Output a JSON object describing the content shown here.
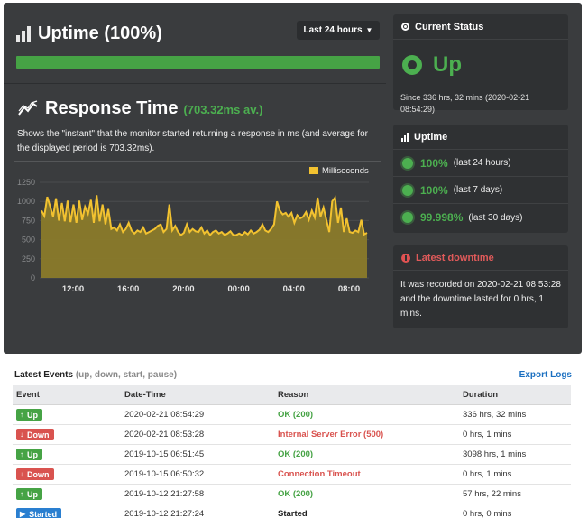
{
  "uptime_header": {
    "title": "Uptime (100%)",
    "range_label": "Last 24 hours",
    "uptime_fraction": 1.0
  },
  "response": {
    "title": "Response Time",
    "average": "(703.32ms av.)",
    "description": "Shows the \"instant\" that the monitor started returning a response in ms (and average for the displayed period is 703.32ms)."
  },
  "chart_data": {
    "type": "area",
    "legend": "Milliseconds",
    "ylim": [
      0,
      1250
    ],
    "yticks": [
      "1250",
      "1000",
      "750",
      "500",
      "250",
      "0"
    ],
    "xticks": [
      "12:00",
      "16:00",
      "20:00",
      "00:00",
      "04:00",
      "08:00"
    ],
    "color": "#f2c230",
    "values": [
      880,
      810,
      1060,
      930,
      800,
      1040,
      750,
      980,
      740,
      1010,
      730,
      960,
      720,
      1010,
      760,
      930,
      840,
      1020,
      720,
      1080,
      740,
      960,
      700,
      900,
      640,
      660,
      620,
      700,
      600,
      640,
      720,
      620,
      580,
      620,
      600,
      660,
      580,
      600,
      620,
      640,
      680,
      700,
      600,
      640,
      960,
      620,
      680,
      600,
      560,
      590,
      700,
      600,
      640,
      610,
      600,
      660,
      580,
      620,
      560,
      600,
      620,
      580,
      600,
      560,
      580,
      610,
      560,
      560,
      580,
      560,
      600,
      570,
      620,
      580,
      600,
      630,
      700,
      620,
      600,
      640,
      700,
      1000,
      880,
      830,
      850,
      800,
      850,
      720,
      820,
      780,
      800,
      860,
      760,
      880,
      790,
      1050,
      800,
      920,
      760,
      600,
      1000,
      1050,
      720,
      920,
      600,
      780,
      600,
      590,
      620,
      600,
      760,
      570,
      590
    ]
  },
  "status_panel": {
    "title": "Current Status",
    "state": "Up",
    "since": "Since 336 hrs, 32 mins (2020-02-21 08:54:29)"
  },
  "uptime_panel": {
    "title": "Uptime",
    "rows": [
      {
        "pct": "100%",
        "period": "(last 24 hours)"
      },
      {
        "pct": "100%",
        "period": "(last 7 days)"
      },
      {
        "pct": "99.998%",
        "period": "(last 30 days)"
      }
    ]
  },
  "downtime_panel": {
    "title": "Latest downtime",
    "text": "It was recorded on 2020-02-21 08:53:28 and the downtime lasted for 0 hrs, 1 mins."
  },
  "events": {
    "title": "Latest Events",
    "subtitle": "(up, down, start, pause)",
    "export_label": "Export Logs",
    "headers": [
      "Event",
      "Date-Time",
      "Reason",
      "Duration"
    ],
    "rows": [
      {
        "type": "up",
        "label": "Up",
        "datetime": "2020-02-21 08:54:29",
        "reason": "OK (200)",
        "duration": "336 hrs, 32 mins"
      },
      {
        "type": "down",
        "label": "Down",
        "datetime": "2020-02-21 08:53:28",
        "reason": "Internal Server Error (500)",
        "duration": "0 hrs, 1 mins"
      },
      {
        "type": "up",
        "label": "Up",
        "datetime": "2019-10-15 06:51:45",
        "reason": "OK (200)",
        "duration": "3098 hrs, 1 mins"
      },
      {
        "type": "down",
        "label": "Down",
        "datetime": "2019-10-15 06:50:32",
        "reason": "Connection Timeout",
        "duration": "0 hrs, 1 mins"
      },
      {
        "type": "up",
        "label": "Up",
        "datetime": "2019-10-12 21:27:58",
        "reason": "OK (200)",
        "duration": "57 hrs, 22 mins"
      },
      {
        "type": "start",
        "label": "Started",
        "datetime": "2019-10-12 21:27:24",
        "reason": "Started",
        "duration": "0 hrs, 0 mins"
      }
    ]
  }
}
